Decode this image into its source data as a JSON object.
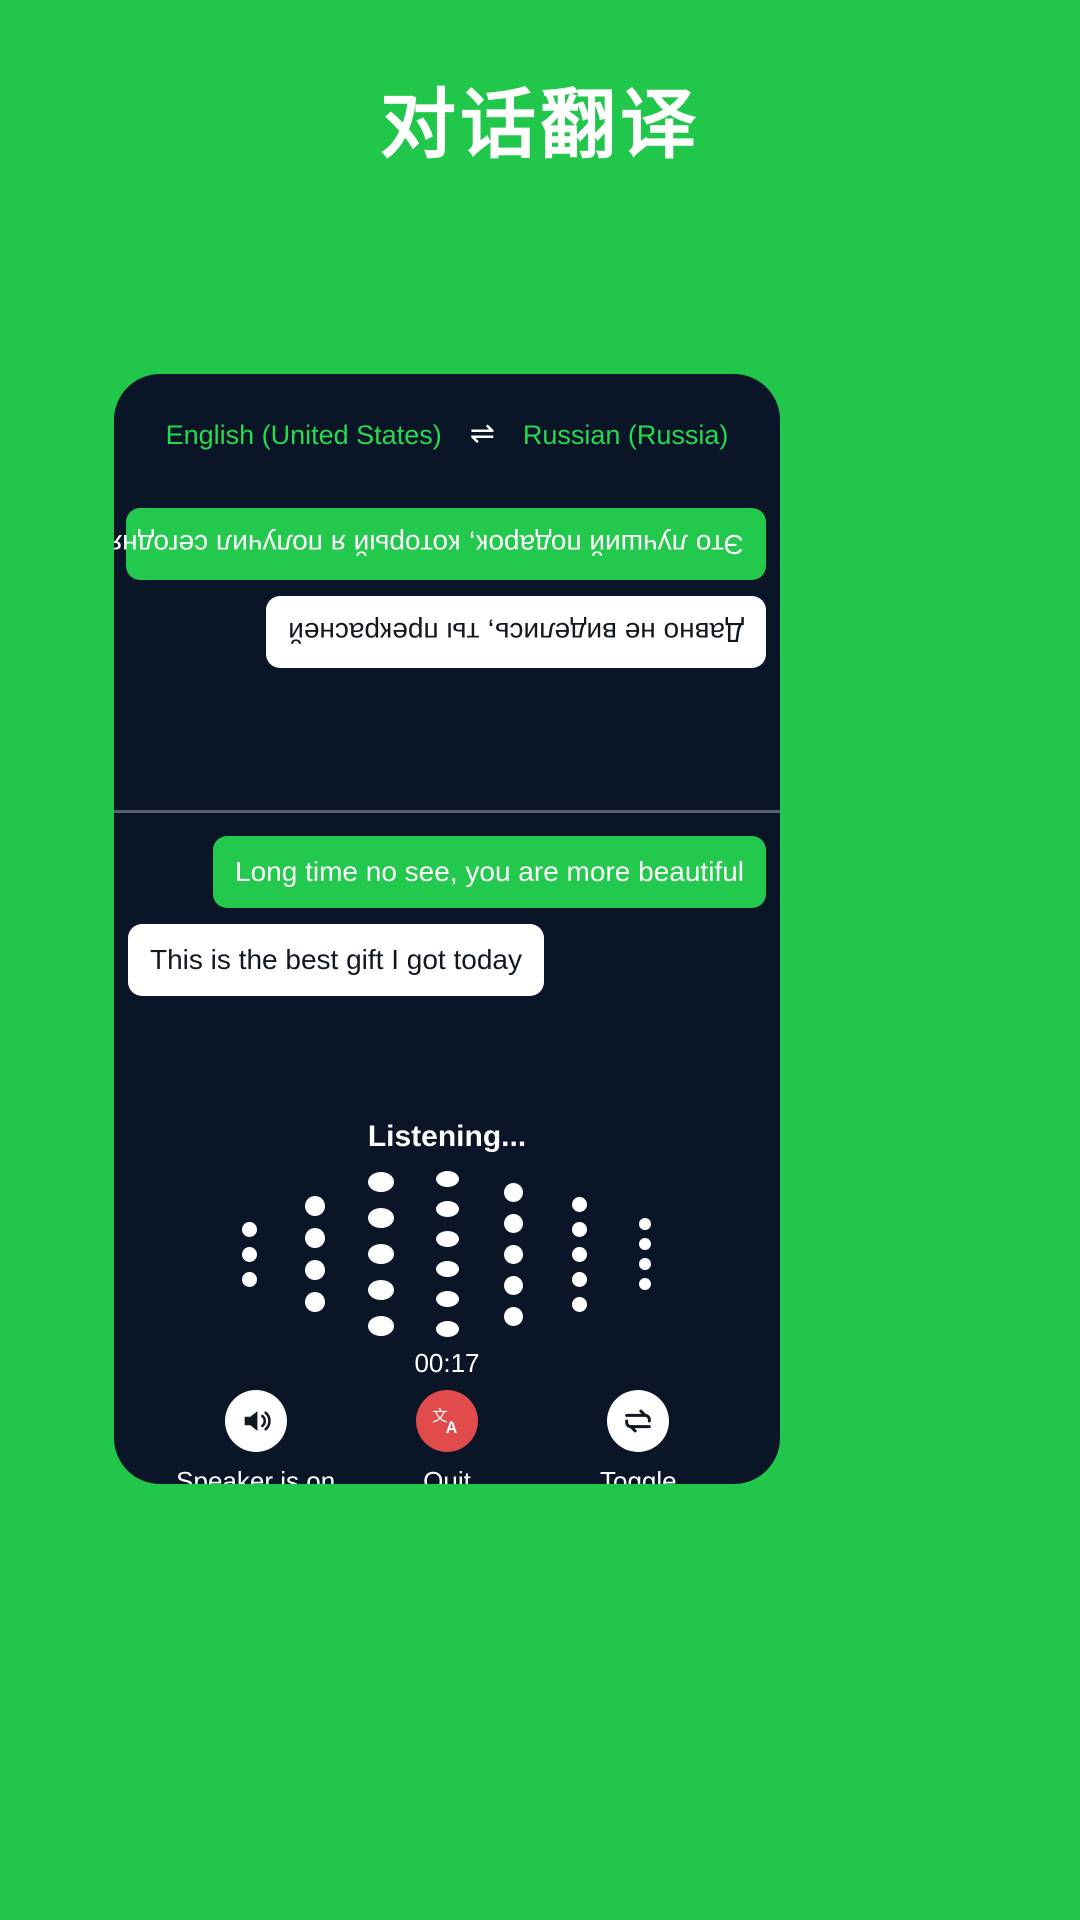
{
  "page": {
    "title": "对话翻译",
    "background_color": "#21c74a",
    "accent_green": "#22c94d",
    "panel_color": "#0a1628",
    "quit_red": "#e14b4b"
  },
  "language_bar": {
    "source_language": "English (United States)",
    "swap_icon": "swap-horizontal-icon",
    "swap_glyph": "⇌",
    "target_language": "Russian (Russia)"
  },
  "conversation": {
    "top_pane_rotated": true,
    "top_messages": [
      {
        "text": "Это лучший подарок, который я получил сегодня",
        "style": "green",
        "align": "left"
      },
      {
        "text": "Давно не виделись, ты прекрасней",
        "style": "white",
        "align": "right"
      }
    ],
    "bottom_messages": [
      {
        "text": "Long time no see, you are more beautiful",
        "style": "green",
        "align": "right"
      },
      {
        "text": "This is the best gift I got today",
        "style": "white",
        "align": "left"
      }
    ]
  },
  "status": {
    "listening_label": "Listening...",
    "timer": "00:17"
  },
  "waveform": {
    "columns": [
      {
        "count": 3,
        "size": 15
      },
      {
        "count": 4,
        "size": 20
      },
      {
        "count": 5,
        "size": 26
      },
      {
        "count": 6,
        "size": 23
      },
      {
        "count": 5,
        "size": 19
      },
      {
        "count": 5,
        "size": 15
      },
      {
        "count": 4,
        "size": 12
      }
    ]
  },
  "controls": [
    {
      "label": "Speaker is on",
      "icon": "speaker-on-icon",
      "circle_style": "white"
    },
    {
      "label": "Quit",
      "icon": "translate-icon",
      "circle_style": "red"
    },
    {
      "label": "Toggle",
      "icon": "toggle-loop-icon",
      "circle_style": "white"
    }
  ]
}
